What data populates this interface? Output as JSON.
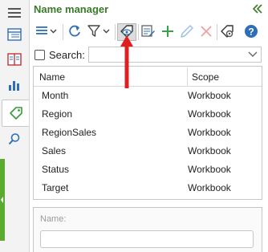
{
  "panel": {
    "title": "Name manager",
    "collapse_icon": "double-chevron-left-icon"
  },
  "rail": {
    "items": [
      {
        "icon": "hamburger-menu-icon"
      },
      {
        "icon": "list-view-icon"
      },
      {
        "icon": "book-icon"
      },
      {
        "icon": "bar-chart-icon"
      },
      {
        "icon": "tag-icon",
        "selected": true
      },
      {
        "icon": "search-icon"
      }
    ]
  },
  "toolbar": {
    "buttons": [
      {
        "icon": "list-menu-icon",
        "dropdown": true
      },
      {
        "icon": "refresh-icon"
      },
      {
        "icon": "filter-icon",
        "dropdown": true
      },
      {
        "icon": "tag-eye-icon",
        "active": true
      },
      {
        "icon": "edit-list-icon"
      },
      {
        "icon": "plus-icon"
      },
      {
        "icon": "pencil-icon"
      },
      {
        "icon": "delete-x-icon"
      },
      {
        "icon": "tag-settings-icon"
      },
      {
        "icon": "help-icon"
      }
    ]
  },
  "search": {
    "label": "Search:",
    "value": "",
    "checked": false
  },
  "table": {
    "columns": [
      "Name",
      "Scope"
    ],
    "rows": [
      {
        "name": "Month",
        "scope": "Workbook"
      },
      {
        "name": "Region",
        "scope": "Workbook"
      },
      {
        "name": "RegionSales",
        "scope": "Workbook"
      },
      {
        "name": "Sales",
        "scope": "Workbook"
      },
      {
        "name": "Status",
        "scope": "Workbook"
      },
      {
        "name": "Target",
        "scope": "Workbook"
      }
    ]
  },
  "detail": {
    "name_label": "Name:",
    "name_value": ""
  },
  "colors": {
    "accent_green": "#3a7a2a",
    "strip_green": "#5aab2f",
    "icon_blue": "#2f6fb7",
    "annotation_red": "#e02020"
  }
}
